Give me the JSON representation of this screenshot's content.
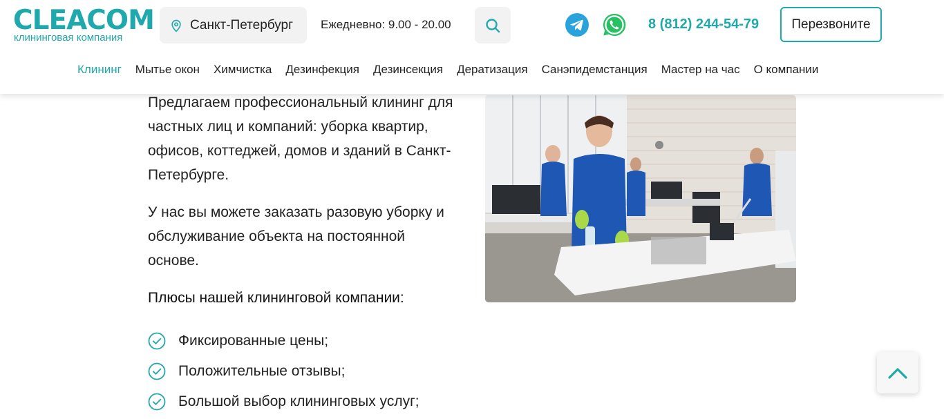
{
  "header": {
    "logo": {
      "name": "CLEACOM",
      "tagline": "клининговая компания"
    },
    "city": "Санкт-Петербург",
    "hours": "Ежедневно: 9.00 - 20.00",
    "phone": "8 (812) 244-54-79",
    "callback_label": "Перезвоните",
    "icons": {
      "location": "map-pin-icon",
      "search": "search-icon",
      "telegram": "telegram-icon",
      "whatsapp": "whatsapp-icon"
    }
  },
  "nav": {
    "items": [
      {
        "label": "Клининг",
        "active": true
      },
      {
        "label": "Мытье окон"
      },
      {
        "label": "Химчистка"
      },
      {
        "label": "Дезинфекция"
      },
      {
        "label": "Дезинсекция"
      },
      {
        "label": "Дератизация"
      },
      {
        "label": "Санэпидемстанция"
      },
      {
        "label": "Мастер на час"
      },
      {
        "label": "О компании"
      }
    ]
  },
  "main": {
    "paragraph1": "Предлагаем профессиональный клининг для частных лиц и компаний: уборка квартир, офисов, коттеджей, домов и зданий в Санкт-Петербурге.",
    "paragraph2": "У нас вы можете заказать разовую уборку и обслуживание объекта на постоянной основе.",
    "advantages_title": "Плюсы нашей клининговой компании:",
    "advantages": [
      "Фиксированные цены;",
      "Положительные отзывы;",
      "Большой выбор клининговых услуг;"
    ]
  },
  "colors": {
    "accent": "#1fa9ac",
    "text": "#222222",
    "pill": "#f2f2f2"
  }
}
